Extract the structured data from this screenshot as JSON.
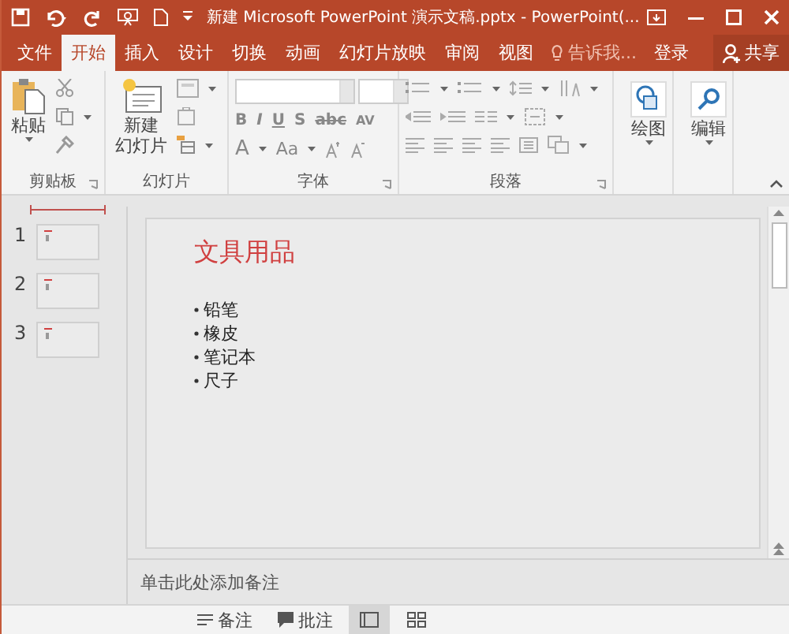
{
  "title_bar": {
    "title": "新建 Microsoft PowerPoint 演示文稿.pptx - PowerPoint(..."
  },
  "tabs": [
    {
      "label": "文件",
      "selected": false
    },
    {
      "label": "开始",
      "selected": true
    },
    {
      "label": "插入",
      "selected": false
    },
    {
      "label": "设计",
      "selected": false
    },
    {
      "label": "切换",
      "selected": false
    },
    {
      "label": "动画",
      "selected": false
    },
    {
      "label": "幻灯片放映",
      "selected": false
    },
    {
      "label": "审阅",
      "selected": false
    },
    {
      "label": "视图",
      "selected": false
    }
  ],
  "tell_me": {
    "placeholder": "告诉我..."
  },
  "sign_in": "登录",
  "share": "共享",
  "ribbon": {
    "groups": [
      {
        "kind": "clipboard",
        "label": "剪贴板",
        "button": "粘贴"
      },
      {
        "kind": "slides",
        "label": "幻灯片",
        "button_line1": "新建",
        "button_line2": "幻灯片"
      },
      {
        "kind": "font",
        "label": "字体",
        "font_buttons": [
          "B",
          "I",
          "U",
          "S",
          "abc",
          "AV"
        ],
        "size_buttons": [
          "A",
          "Aa"
        ]
      },
      {
        "kind": "paragraph",
        "label": "段落"
      },
      {
        "kind": "big",
        "button": "绘图"
      },
      {
        "kind": "big",
        "button": "编辑"
      }
    ]
  },
  "thumbnails": [
    {
      "number": "1"
    },
    {
      "number": "2"
    },
    {
      "number": "3"
    }
  ],
  "slide": {
    "title": "文具用品",
    "bullets": [
      "铅笔",
      "橡皮",
      "笔记本",
      "尺子"
    ]
  },
  "notes": {
    "placeholder": "单击此处添加备注"
  },
  "status_bar": {
    "notes": "备注",
    "comments": "批注"
  }
}
